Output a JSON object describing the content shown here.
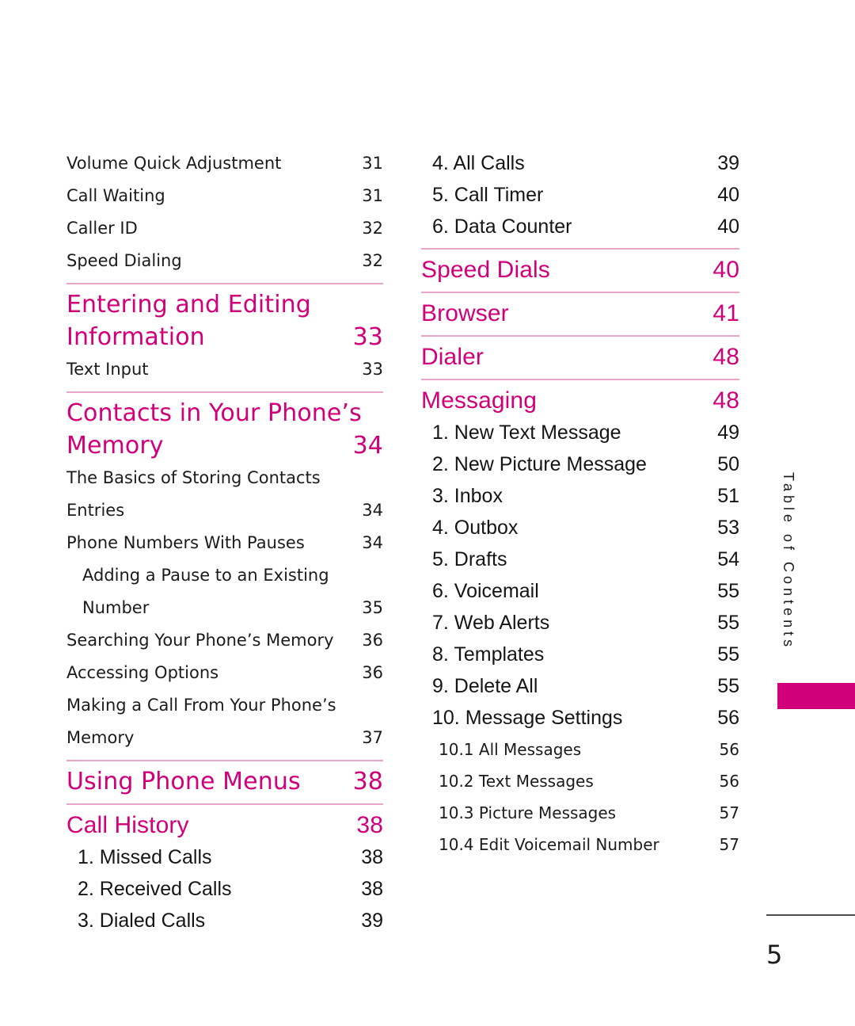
{
  "page": {
    "folio": "5",
    "side_tab_label": "Table of Contents",
    "accent_color": "#d1007a",
    "rule_color": "#e9a6c8",
    "text_color": "#1b1b1b"
  },
  "left_column": [
    {
      "kind": "entry",
      "label": "Volume Quick Adjustment",
      "page": "31"
    },
    {
      "kind": "entry",
      "label": "Call Waiting",
      "page": "31"
    },
    {
      "kind": "entry",
      "label": "Caller ID",
      "page": "32"
    },
    {
      "kind": "entry",
      "label": "Speed Dialing",
      "page": "32"
    },
    {
      "kind": "rule"
    },
    {
      "kind": "heading2",
      "line1": "Entering and Editing",
      "line2": "Information",
      "page": "33",
      "font": "hum"
    },
    {
      "kind": "entry",
      "label": "Text Input",
      "page": "33"
    },
    {
      "kind": "rule"
    },
    {
      "kind": "heading2",
      "line1": "Contacts in Your Phone’s",
      "line2": "Memory",
      "page": "34",
      "font": "hum"
    },
    {
      "kind": "entry2",
      "line1": "The Basics of Storing Contacts",
      "line2": "Entries",
      "page": "34"
    },
    {
      "kind": "entry",
      "label": "Phone Numbers With Pauses",
      "page": "34"
    },
    {
      "kind": "entry2",
      "line1": "Adding a Pause to an Existing",
      "line2": "Number",
      "page": "35",
      "indent": true
    },
    {
      "kind": "entry",
      "label": "Searching Your Phone’s Memory",
      "page": "36"
    },
    {
      "kind": "entry",
      "label": "Accessing Options",
      "page": "36"
    },
    {
      "kind": "entry2",
      "line1": "Making a Call From Your Phone’s",
      "line2": "Memory",
      "page": "37"
    },
    {
      "kind": "rule"
    },
    {
      "kind": "heading1",
      "label": "Using Phone Menus",
      "page": "38",
      "font": "hum"
    },
    {
      "kind": "rule"
    },
    {
      "kind": "heading1",
      "label": "Call History",
      "page": "38",
      "font": "grot"
    },
    {
      "kind": "numbered",
      "label": "1. Missed Calls",
      "page": "38"
    },
    {
      "kind": "numbered",
      "label": "2. Received Calls",
      "page": "38"
    },
    {
      "kind": "numbered",
      "label": "3. Dialed Calls",
      "page": "39"
    }
  ],
  "right_column": [
    {
      "kind": "numbered",
      "label": "4. All Calls",
      "page": "39"
    },
    {
      "kind": "numbered",
      "label": "5. Call Timer",
      "page": "40"
    },
    {
      "kind": "numbered",
      "label": "6. Data Counter",
      "page": "40"
    },
    {
      "kind": "rule"
    },
    {
      "kind": "heading1",
      "label": "Speed Dials",
      "page": "40",
      "font": "grot"
    },
    {
      "kind": "rule"
    },
    {
      "kind": "heading1",
      "label": "Browser",
      "page": "41",
      "font": "grot"
    },
    {
      "kind": "rule"
    },
    {
      "kind": "heading1",
      "label": "Dialer",
      "page": "48",
      "font": "grot"
    },
    {
      "kind": "rule"
    },
    {
      "kind": "heading1",
      "label": "Messaging",
      "page": "48",
      "font": "grot"
    },
    {
      "kind": "numbered",
      "label": "1. New Text Message",
      "page": "49"
    },
    {
      "kind": "numbered",
      "label": "2.  New Picture Message",
      "page": "50"
    },
    {
      "kind": "numbered",
      "label": "3. Inbox",
      "page": "51"
    },
    {
      "kind": "numbered",
      "label": "4. Outbox",
      "page": "53"
    },
    {
      "kind": "numbered",
      "label": "5. Drafts",
      "page": "54"
    },
    {
      "kind": "numbered",
      "label": "6. Voicemail",
      "page": "55"
    },
    {
      "kind": "numbered",
      "label": "7. Web Alerts",
      "page": "55"
    },
    {
      "kind": "numbered",
      "label": "8. Templates",
      "page": "55"
    },
    {
      "kind": "numbered",
      "label": "9. Delete All",
      "page": "55"
    },
    {
      "kind": "numbered",
      "label": "10. Message Settings",
      "page": "56"
    },
    {
      "kind": "sub",
      "label": "10.1  All Messages",
      "page": "56"
    },
    {
      "kind": "sub",
      "label": "10.2  Text Messages",
      "page": "56"
    },
    {
      "kind": "sub",
      "label": "10.3  Picture Messages",
      "page": "57"
    },
    {
      "kind": "sub",
      "label": "10.4  Edit Voicemail Number",
      "page": "57"
    }
  ]
}
